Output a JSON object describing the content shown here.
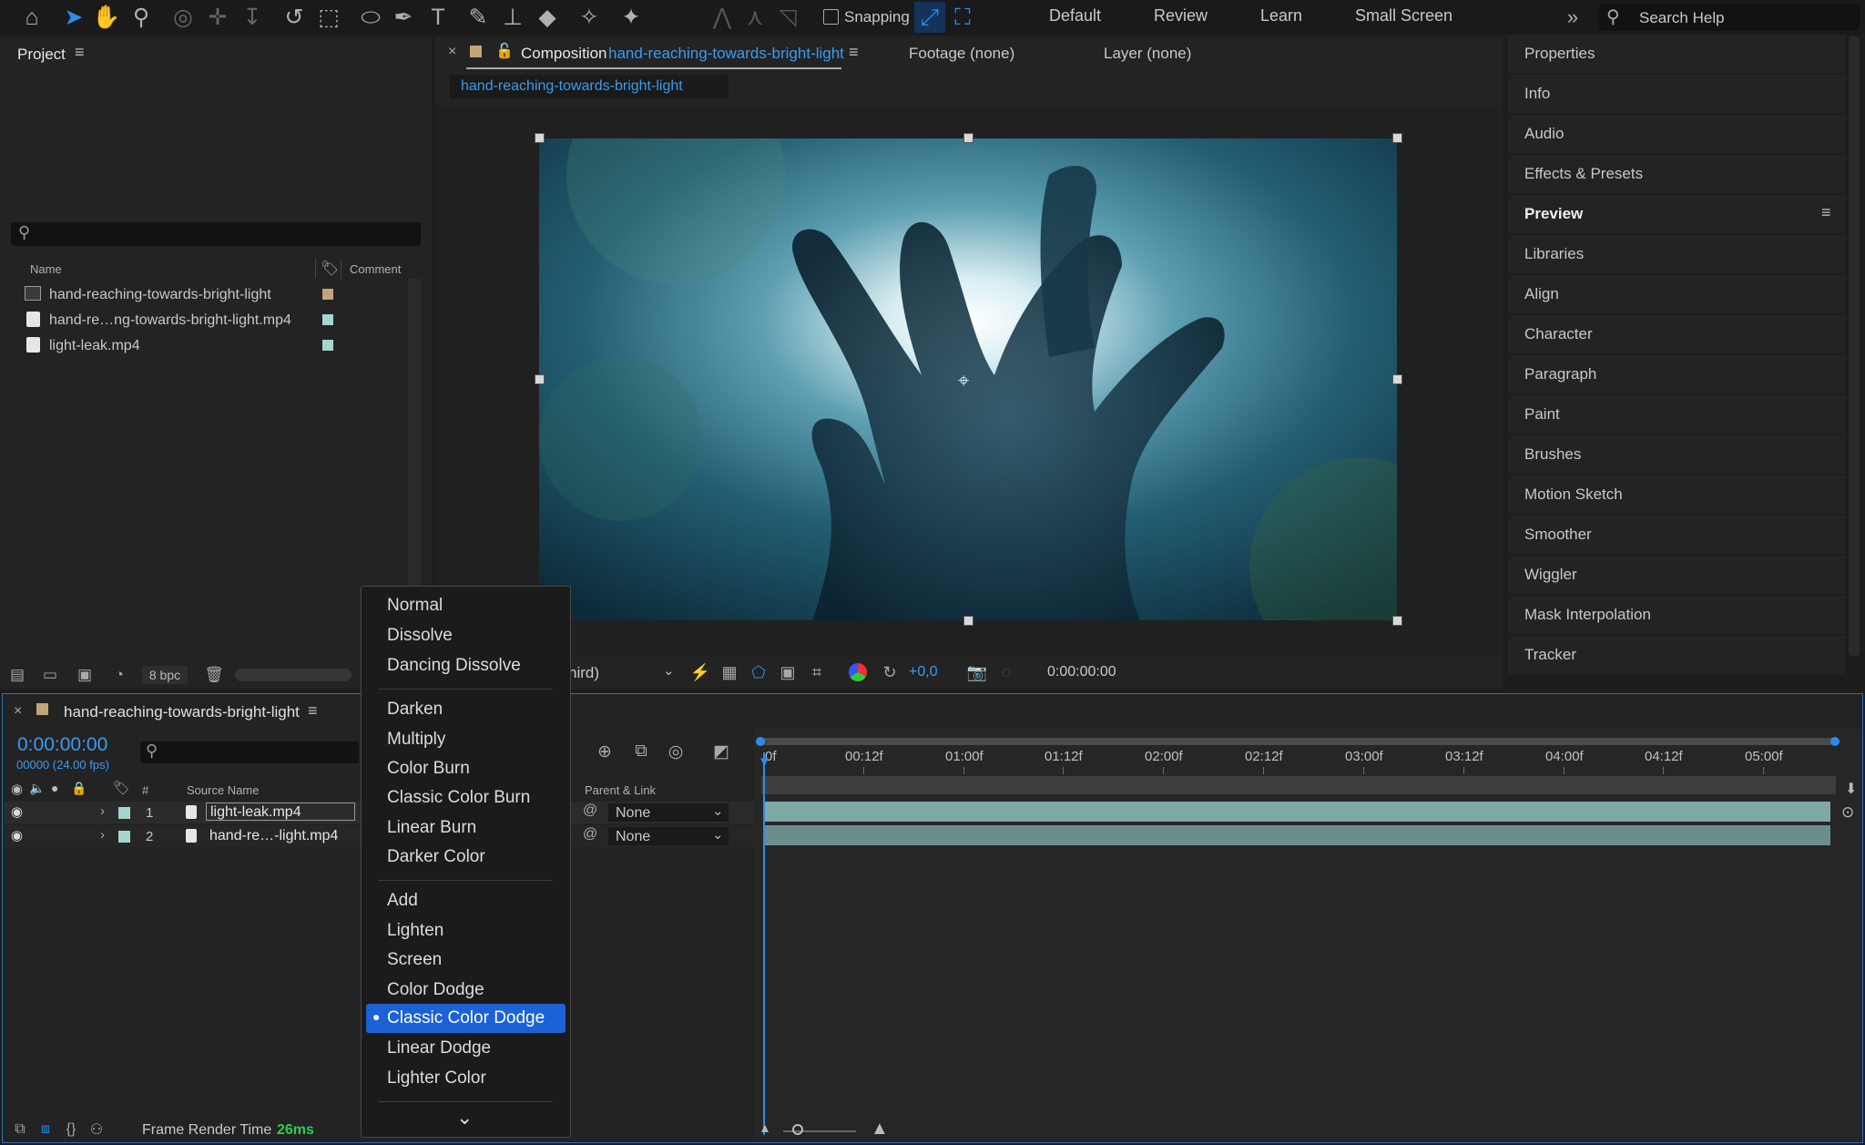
{
  "toolbar": {
    "snapping_label": "Snapping",
    "workspaces": [
      "Default",
      "Review",
      "Learn",
      "Small Screen"
    ],
    "search_placeholder": "Search Help"
  },
  "project": {
    "title": "Project",
    "col_name": "Name",
    "col_comment": "Comment",
    "items": [
      {
        "name": "hand-reaching-towards-bright-light",
        "color": "#c2a57a"
      },
      {
        "name": "hand-re…ng-towards-bright-light.mp4",
        "color": "#a6d4cf"
      },
      {
        "name": "light-leak.mp4",
        "color": "#a6d4cf"
      }
    ],
    "bpc": "8 bpc"
  },
  "composition": {
    "tab_label": "Composition",
    "tab_name": "hand-reaching-towards-bright-light",
    "footage_label": "Footage (none)",
    "layer_label": "Layer (none)",
    "flow_tab": "hand-reaching-towards-bright-light",
    "resolution_partial": "hird)",
    "exposure": "+0,0",
    "timecode": "0:00:00:00"
  },
  "right_panel": {
    "items": [
      "Properties",
      "Info",
      "Audio",
      "Effects & Presets",
      "Preview",
      "Libraries",
      "Align",
      "Character",
      "Paragraph",
      "Paint",
      "Brushes",
      "Motion Sketch",
      "Smoother",
      "Wiggler",
      "Mask Interpolation",
      "Tracker"
    ]
  },
  "timeline": {
    "comp_name": "hand-reaching-towards-bright-light",
    "timecode": "0:00:00:00",
    "frames": "00000 (24.00 fps)",
    "col_num": "#",
    "col_source": "Source Name",
    "col_parent": "Parent & Link",
    "layers": [
      {
        "num": "1",
        "name": "light-leak.mp4",
        "parent": "None",
        "color": "#a6d4cf"
      },
      {
        "num": "2",
        "name": "hand-re…-light.mp4",
        "parent": "None",
        "color": "#a6d4cf"
      }
    ],
    "ruler": [
      "0f",
      "00:12f",
      "01:00f",
      "01:12f",
      "02:00f",
      "02:12f",
      "03:00f",
      "03:12f",
      "04:00f",
      "04:12f",
      "05:00f"
    ],
    "render_label": "Frame Render Time",
    "render_value": "26ms"
  },
  "blend_menu": {
    "group1": [
      "Normal",
      "Dissolve",
      "Dancing Dissolve"
    ],
    "group2": [
      "Darken",
      "Multiply",
      "Color Burn",
      "Classic Color Burn",
      "Linear Burn",
      "Darker Color"
    ],
    "group3": [
      "Add",
      "Lighten",
      "Screen",
      "Color Dodge",
      "Classic Color Dodge",
      "Linear Dodge",
      "Lighter Color"
    ],
    "selected": "Classic Color Dodge"
  },
  "colors": {
    "accent": "#2d8ceb",
    "selection": "#1a62d6",
    "comp_swatch": "#c2a57a"
  }
}
